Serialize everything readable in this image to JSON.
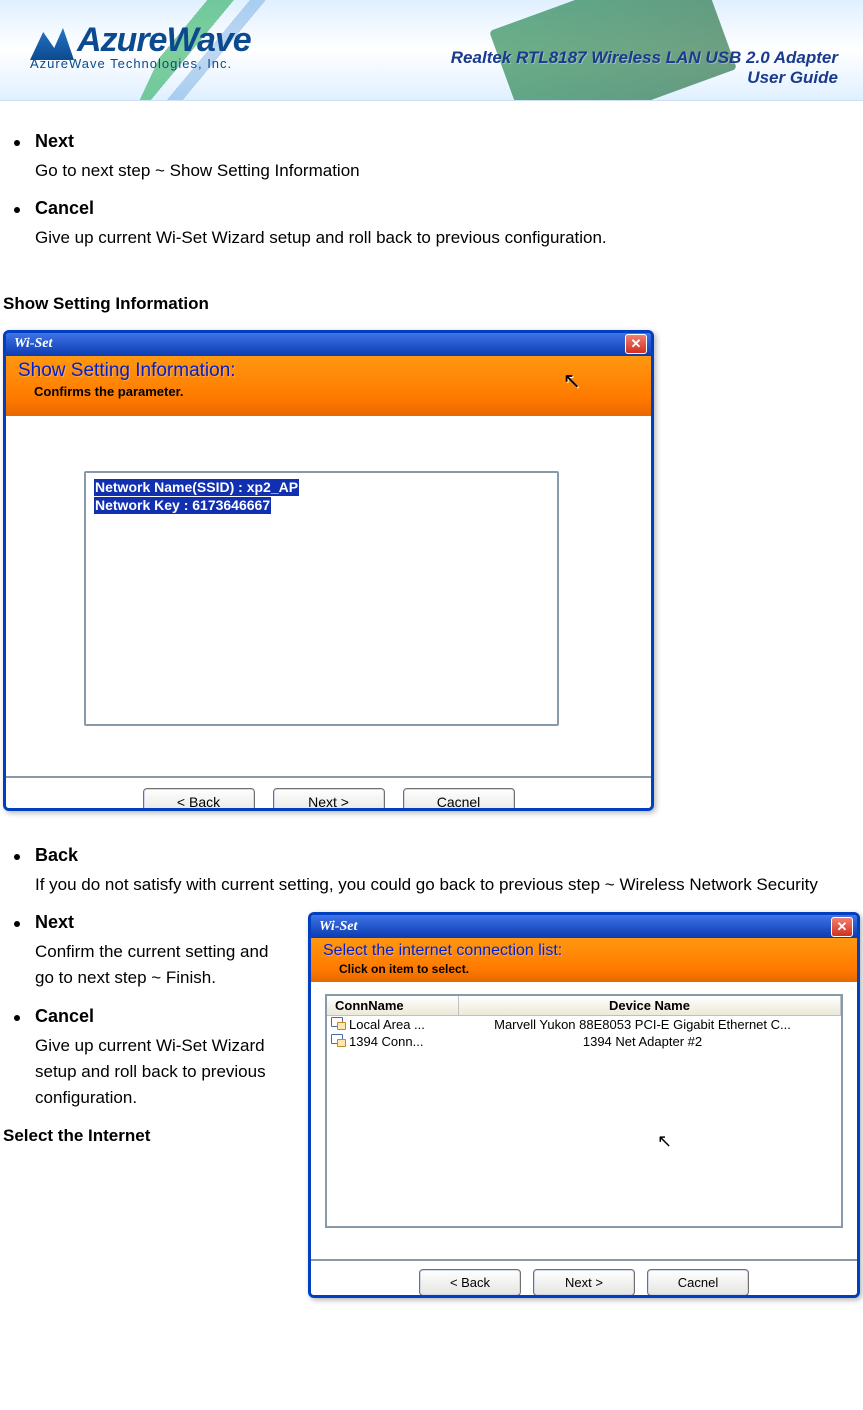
{
  "header": {
    "logo_text": "AzureWave",
    "logo_sub": "AzureWave  Technologies,  Inc.",
    "title_line1": "Realtek RTL8187 Wireless LAN USB 2.0 Adapter",
    "title_line2": "User Guide"
  },
  "top_list": [
    {
      "term": "Next",
      "desc": "Go to next step ~ Show Setting Information"
    },
    {
      "term": "Cancel",
      "desc": "Give up current Wi-Set Wizard setup and roll back to previous configuration."
    }
  ],
  "section1_heading": "Show Setting Information",
  "wiset1": {
    "window_title": "Wi-Set",
    "header_title": "Show Setting Information:",
    "header_sub": "Confirms the parameter.",
    "highlight_line1": "Network Name(SSID) : xp2_AP",
    "highlight_line2": "Network Key : 6173646667",
    "btn_back": "< Back",
    "btn_next": "Next >",
    "btn_cancel": "Cacnel"
  },
  "mid_list": [
    {
      "term": "Back",
      "desc": "If you do not satisfy with current setting, you could go back to previous step ~ Wireless Network Security"
    },
    {
      "term": "Next",
      "desc": "Confirm the current setting and go to next step ~ Finish."
    },
    {
      "term": "Cancel",
      "desc": "Give up current Wi-Set Wizard setup and roll back to previous configuration."
    }
  ],
  "section2_heading": "Select the Internet",
  "wiset2": {
    "window_title": "Wi-Set",
    "header_title": "Select the internet connection list:",
    "header_sub": "Click on item to select.",
    "col_conn": "ConnName",
    "col_dev": "Device Name",
    "rows": [
      {
        "conn": "Local Area ...",
        "dev": "Marvell Yukon 88E8053 PCI-E Gigabit Ethernet C..."
      },
      {
        "conn": "1394 Conn...",
        "dev": "1394 Net Adapter #2"
      }
    ],
    "btn_back": "< Back",
    "btn_next": "Next >",
    "btn_cancel": "Cacnel"
  }
}
